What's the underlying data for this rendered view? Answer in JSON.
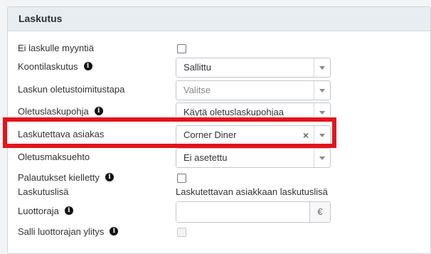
{
  "panel": {
    "title": "Laskutus"
  },
  "fields": {
    "no_invoice_sale": {
      "label": "Ei laskulle myyntiä",
      "checked": false
    },
    "collective_invoicing": {
      "label": "Koontilaskutus",
      "info_icon": "info-icon",
      "value": "Sallittu"
    },
    "default_delivery_method": {
      "label": "Laskun oletustoimitustapa",
      "placeholder": "Valitse"
    },
    "default_invoice_template": {
      "label": "Oletuslaskupohja",
      "info_icon": "info-icon",
      "value": "Käytä oletuslaskupohjaa"
    },
    "invoiced_customer": {
      "label": "Laskutettava asiakas",
      "value": "Corner Diner",
      "clear_symbol": "×"
    },
    "default_payment_term": {
      "label": "Oletusmaksuehto",
      "value": "Ei asetettu"
    },
    "returns_prohibited": {
      "label": "Palautukset kielletty",
      "info_icon": "info-icon",
      "checked": false
    },
    "invoice_extra": {
      "label": "Laskutuslisä",
      "value": "Laskutettavan asiakkaan laskutuslisä"
    },
    "credit_limit": {
      "label": "Luottoraja",
      "info_icon": "info-icon",
      "value": "",
      "currency": "€"
    },
    "allow_exceed_credit": {
      "label": "Salli luottorajan ylitys",
      "info_icon": "info-icon",
      "checked": false,
      "disabled": true
    }
  },
  "colors": {
    "highlight": "#e3141b",
    "header_bg": "#e8edf2"
  }
}
